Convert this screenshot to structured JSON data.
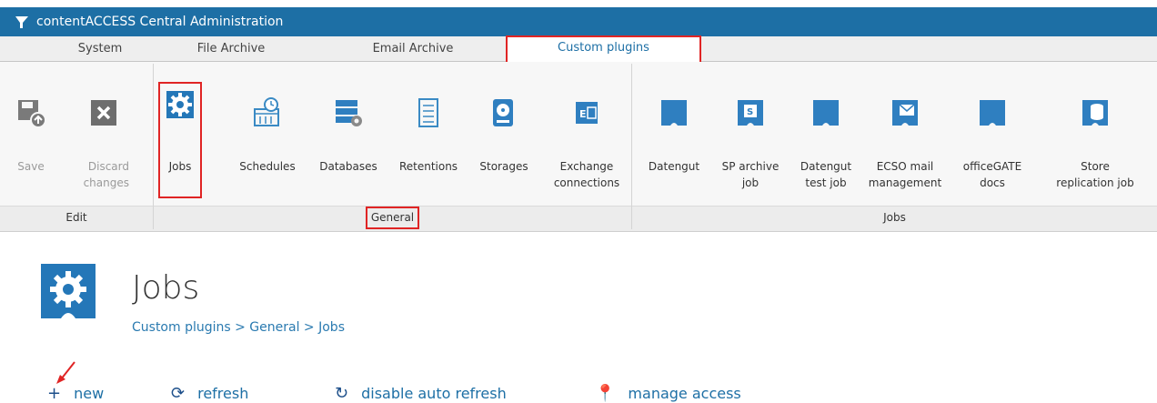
{
  "app": {
    "title": "contentACCESS Central Administration"
  },
  "tabs": [
    {
      "label": "System"
    },
    {
      "label": "File Archive"
    },
    {
      "label": "Email Archive"
    },
    {
      "label": "Custom plugins",
      "active": true
    }
  ],
  "ribbon": {
    "edit": {
      "group_label": "Edit",
      "save": "Save",
      "discard": "Discard\nchanges"
    },
    "general": {
      "group_label": "General",
      "jobs": "Jobs",
      "schedules": "Schedules",
      "databases": "Databases",
      "retentions": "Retentions",
      "storages": "Storages",
      "exchange": "Exchange\nconnections"
    },
    "jobs_group": {
      "group_label": "Jobs",
      "datengut": "Datengut",
      "sp_archive": "SP archive\njob",
      "datengut_test": "Datengut\ntest job",
      "ecso": "ECSO mail\nmanagement",
      "officegate": "officeGATE\ndocs",
      "store_replication": "Store\nreplication job"
    }
  },
  "page": {
    "title": "Jobs",
    "breadcrumb": "Custom plugins > General > Jobs"
  },
  "actions": {
    "new": "new",
    "refresh": "refresh",
    "disable_auto_refresh": "disable auto refresh",
    "manage_access": "manage access"
  },
  "colors": {
    "titlebar": "#1d6fa5",
    "accent": "#1d6fa5",
    "highlight": "#e02424"
  }
}
